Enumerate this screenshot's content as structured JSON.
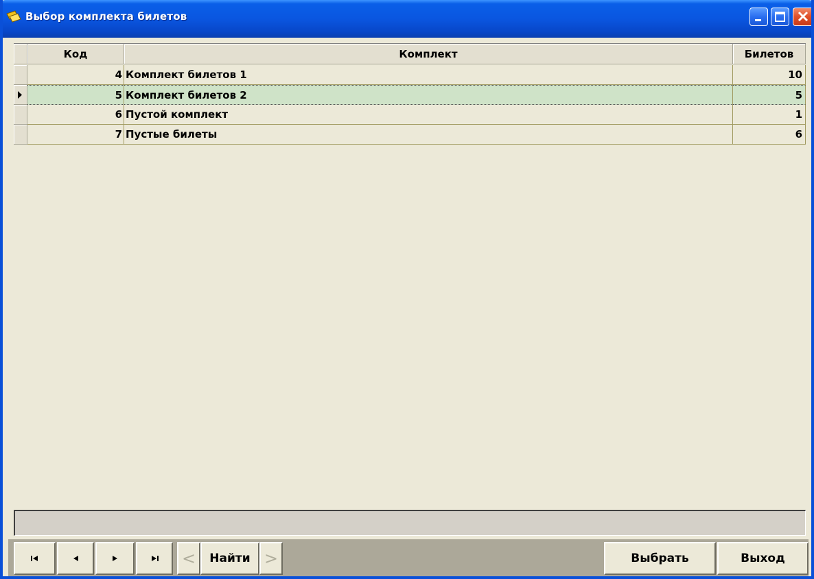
{
  "window": {
    "title": "Выбор комплекта билетов"
  },
  "grid": {
    "columns": [
      "Код",
      "Комплект",
      "Билетов"
    ],
    "rows": [
      {
        "code": "4",
        "name": "Комплект билетов 1",
        "count": "10"
      },
      {
        "code": "5",
        "name": "Комплект билетов 2",
        "count": "5"
      },
      {
        "code": "6",
        "name": "Пустой комплект",
        "count": "1"
      },
      {
        "code": "7",
        "name": "Пустые билеты",
        "count": "6"
      }
    ],
    "selected_row": 1
  },
  "toolbar": {
    "find_label": "Найти",
    "find_prev_glyph": "<",
    "find_next_glyph": ">",
    "choose_label": "Выбрать",
    "exit_label": "Выход"
  },
  "colors": {
    "titlebar": "#0a56e0",
    "selected_row": "#cfe3c8",
    "window_bg": "#ece9d8"
  }
}
